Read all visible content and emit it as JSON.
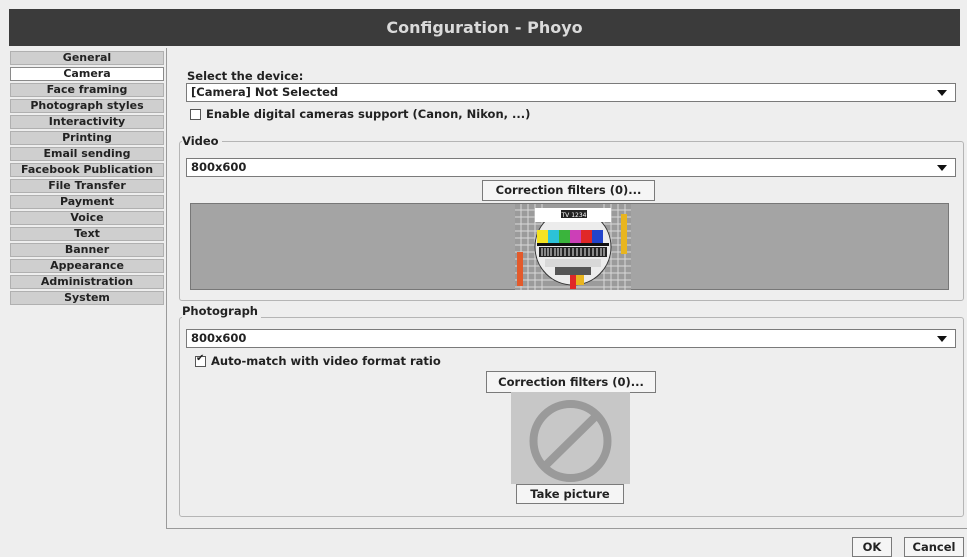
{
  "window": {
    "title": "Configuration - Phoyo"
  },
  "sidebar": {
    "items": [
      {
        "label": "General"
      },
      {
        "label": "Camera"
      },
      {
        "label": "Face framing"
      },
      {
        "label": "Photograph styles"
      },
      {
        "label": "Interactivity"
      },
      {
        "label": "Printing"
      },
      {
        "label": "Email sending"
      },
      {
        "label": "Facebook Publication"
      },
      {
        "label": "File Transfer"
      },
      {
        "label": "Payment"
      },
      {
        "label": "Voice"
      },
      {
        "label": "Text"
      },
      {
        "label": "Banner"
      },
      {
        "label": "Appearance"
      },
      {
        "label": "Administration"
      },
      {
        "label": "System"
      }
    ],
    "selected": "Camera"
  },
  "device": {
    "label": "Select the device:",
    "selected": "[Camera] Not Selected",
    "digital_support": {
      "label": "Enable digital cameras support (Canon, Nikon, ...)",
      "checked": false
    }
  },
  "video": {
    "title": "Video",
    "format": "800x600",
    "filters_button": "Correction filters (0)...",
    "test_pattern_text": "TV 1234"
  },
  "photograph": {
    "title": "Photograph",
    "format": "800x600",
    "auto_match": {
      "label": "Auto-match with video format ratio",
      "checked": true
    },
    "filters_button": "Correction filters (0)...",
    "take_picture_button": "Take picture"
  },
  "footer": {
    "ok": "OK",
    "cancel": "Cancel"
  }
}
